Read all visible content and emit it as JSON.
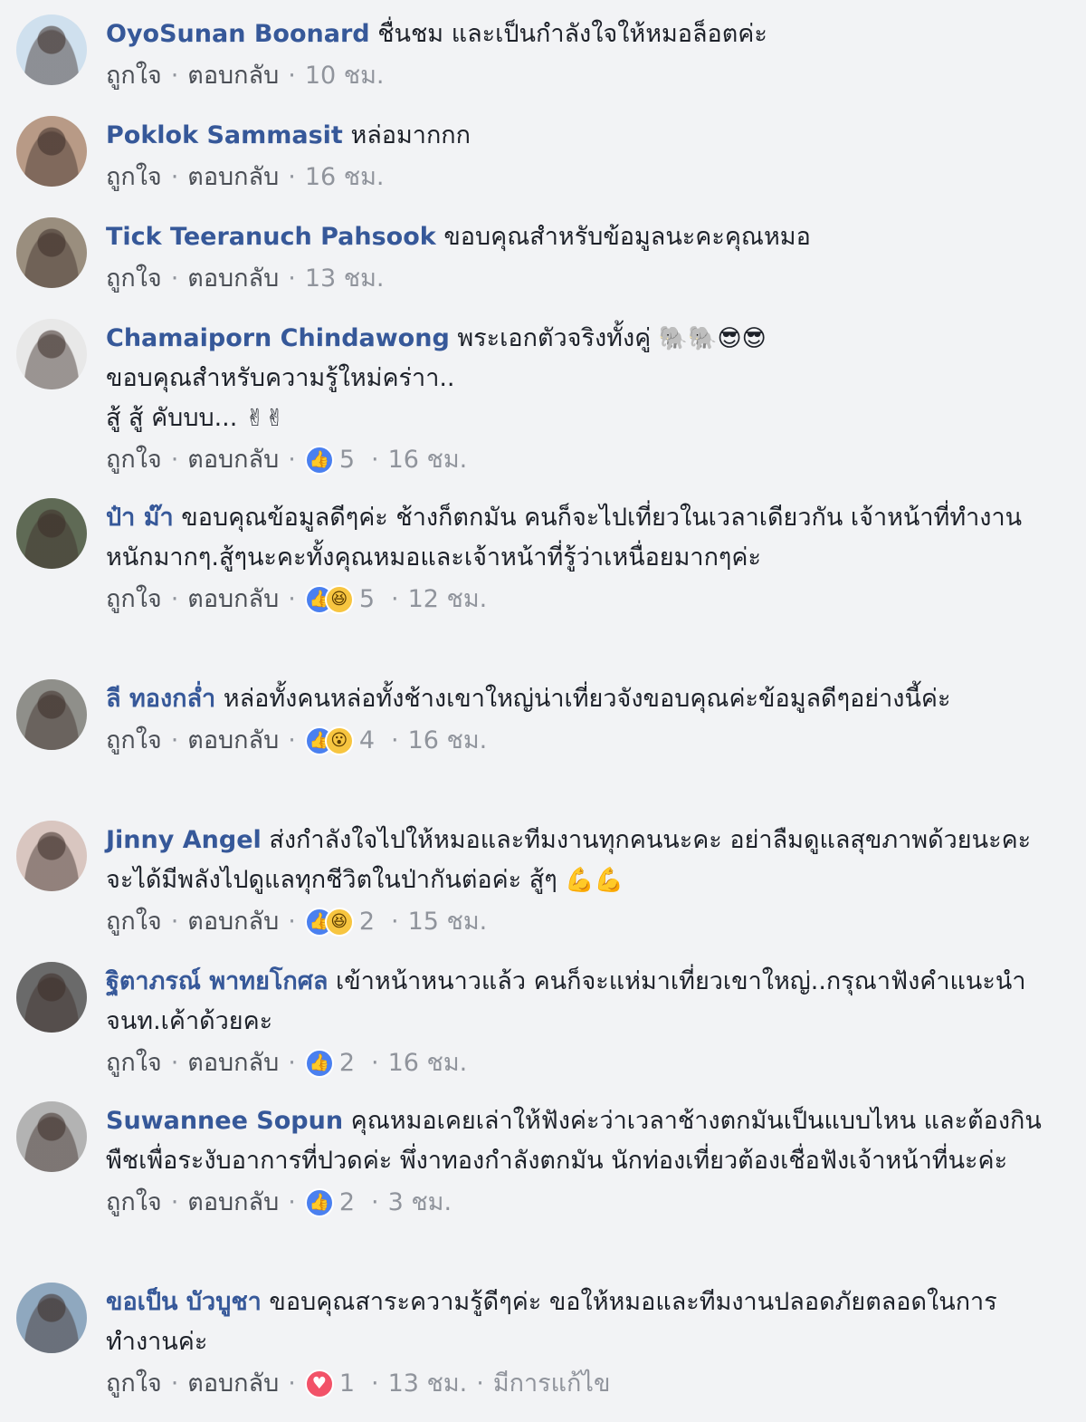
{
  "labels": {
    "like": "ถูกใจ",
    "reply": "ตอบกลับ",
    "dot": "·"
  },
  "colors": {
    "name": "#365899",
    "meta": "#90949c",
    "like": "#4a80f0",
    "love": "#f25268",
    "haha": "#f7c540"
  },
  "comments": [
    {
      "name": "OyoSunan Boonard",
      "text": "ชื่นชม และเป็นกำลังใจให้หมอล็อตค่ะ",
      "emoji": "",
      "reactions": [],
      "reaction_count": "",
      "time": "10 ชม.",
      "edited": "",
      "avatar_color": "#cfe0ee"
    },
    {
      "name": "Poklok Sammasit",
      "text": "หล่อมากกก",
      "emoji": "",
      "reactions": [],
      "reaction_count": "",
      "time": "16 ชม.",
      "edited": "",
      "avatar_color": "#b89a86"
    },
    {
      "name": "Tick Teeranuch Pahsook",
      "text": "ขอบคุณสำหรับข้อมูลนะคะคุณหมอ",
      "emoji": "",
      "reactions": [],
      "reaction_count": "",
      "time": "13 ชม.",
      "edited": "",
      "avatar_color": "#9a8e7e"
    },
    {
      "name": "Chamaiporn Chindawong",
      "text": "พระเอกตัวจริงทั้งคู่ ",
      "emoji": "🐘🐘😎😎",
      "line2": "ขอบคุณสำหรับความรู้ใหม่คร่าา..",
      "line3": "สู้ สู้ คับบบ... ",
      "line3_emoji": "✌✌",
      "reactions": [
        "like"
      ],
      "reaction_count": "5",
      "time": "16 ชม.",
      "edited": "",
      "avatar_color": "#e8e8e8"
    },
    {
      "name": "ป๋า ม๊า",
      "text": "ขอบคุณข้อมูลดีๆค่ะ ช้างก็ตกมัน คนก็จะไปเที่ยวในเวลาเดียวกัน เจ้าหน้าที่ทำงานหนักมากๆ.สู้ๆนะคะทั้งคุณหมอและเจ้าหน้าที่รู้ว่าเหนื่อยมากๆค่ะ",
      "emoji": "",
      "reactions": [
        "like",
        "haha"
      ],
      "reaction_count": "5",
      "time": "12 ชม.",
      "edited": "",
      "avatar_color": "#5f6a55"
    },
    {
      "name": "ลี ทองกล่ำ",
      "text": "หล่อทั้งคนหล่อทั้งช้างเขาใหญ่น่าเที่ยวจังขอบคุณค่ะข้อมูลดีๆอย่างนี้ค่ะ",
      "emoji": "",
      "reactions": [
        "like",
        "wow"
      ],
      "reaction_count": "4",
      "time": "16 ชม.",
      "edited": "",
      "avatar_color": "#8f8f8a"
    },
    {
      "name": "Jinny Angel",
      "text": "ส่งกำลังใจไปให้หมอและทีมงานทุกคนนะคะ อย่าลืมดูแลสุขภาพด้วยนะคะ จะได้มีพลังไปดูแลทุกชีวิตในป่ากันต่อค่ะ สู้ๆ ",
      "emoji": "💪💪",
      "reactions": [
        "like",
        "haha"
      ],
      "reaction_count": "2",
      "time": "15 ชม.",
      "edited": "",
      "avatar_color": "#d9c6c0"
    },
    {
      "name": "ฐิตาภรณ์ พาทยโกศล",
      "text": "เข้าหน้าหนาวแล้ว คนก็จะแห่มาเที่ยวเขาใหญ่..กรุณาฟังคำแนะนำจนท.เค้าด้วยคะ",
      "emoji": "",
      "reactions": [
        "like"
      ],
      "reaction_count": "2",
      "time": "16 ชม.",
      "edited": "",
      "avatar_color": "#6a6a6a"
    },
    {
      "name": "Suwannee Sopun",
      "text": "คุณหมอเคยเล่าให้ฟังค่ะว่าเวลาช้างตกมันเป็นแบบไหน และต้องกินพืชเพื่อระงับอาการที่ปวดค่ะ พึ่งาทองกำลังตกมัน นักท่องเที่ยวต้องเชื่อฟังเจ้าหน้าที่นะค่ะ",
      "emoji": "",
      "reactions": [
        "like"
      ],
      "reaction_count": "2",
      "time": "3 ชม.",
      "edited": "",
      "avatar_color": "#b3b3b3"
    },
    {
      "name": "ขอเป็น บัวบูชา",
      "text": "ขอบคุณสาระความรู้ดีๆค่ะ ขอให้หมอและทีมงานปลอดภัยตลอดในการทำงานค่ะ",
      "emoji": "",
      "reactions": [
        "love"
      ],
      "reaction_count": "1",
      "time": "13 ชม.",
      "edited": "มีการแก้ไข",
      "avatar_color": "#8fa8bf"
    }
  ]
}
